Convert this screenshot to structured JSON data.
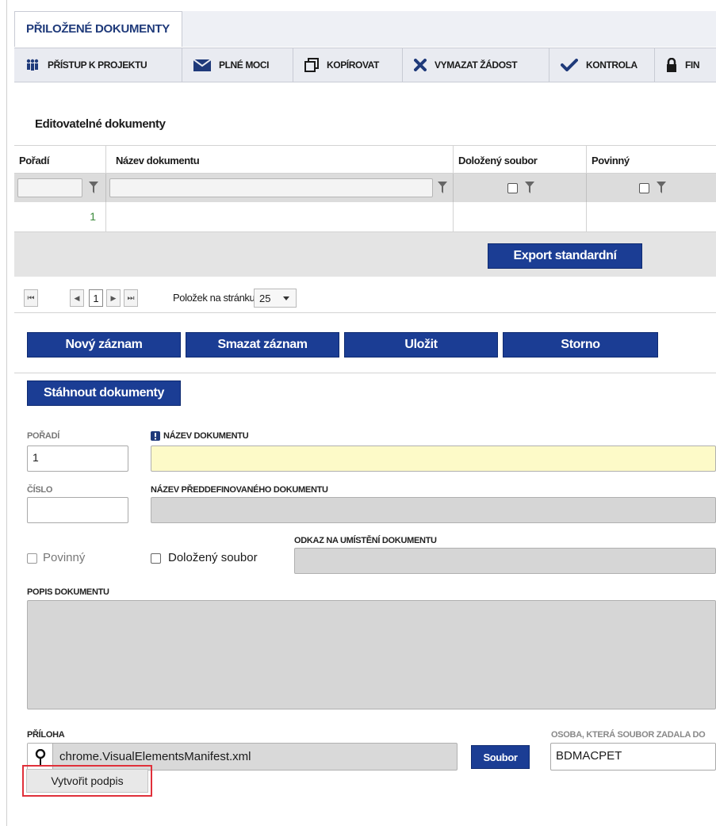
{
  "tab": {
    "title": "PŘILOŽENÉ DOKUMENTY"
  },
  "toolbar": [
    {
      "label": "PŘÍSTUP K PROJEKTU",
      "icon": "people-icon"
    },
    {
      "label": "PLNÉ MOCI",
      "icon": "envelope-icon"
    },
    {
      "label": "KOPÍROVAT",
      "icon": "copy-icon"
    },
    {
      "label": "VYMAZAT ŽÁDOST",
      "icon": "cross-icon"
    },
    {
      "label": "KONTROLA",
      "icon": "check-icon"
    },
    {
      "label": "FIN",
      "icon": "lock-icon"
    }
  ],
  "section_title": "Editovatelné dokumenty",
  "grid": {
    "columns": [
      "Pořadí",
      "Název dokumentu",
      "Doložený soubor",
      "Povinný"
    ],
    "rows": [
      {
        "poradi": "1",
        "nazev": "",
        "dolozeny": "",
        "povinny": ""
      }
    ],
    "export_label": "Export standardní"
  },
  "pager": {
    "first": "⏮",
    "prev": "◀",
    "current": "1",
    "next": "▶",
    "last": "⏭",
    "per_page_label": "Položek na stránku",
    "per_page_value": "25"
  },
  "actions": {
    "new": "Nový záznam",
    "delete": "Smazat záznam",
    "save": "Uložit",
    "cancel": "Storno",
    "download": "Stáhnout dokumenty"
  },
  "form": {
    "poradi_label": "POŘADÍ",
    "poradi_value": "1",
    "nazev_label": "NÁZEV DOKUMENTU",
    "nazev_value": "",
    "cislo_label": "ČÍSLO",
    "cislo_value": "",
    "predef_label": "NÁZEV PŘEDDEFINOVANÉHO DOKUMENTU",
    "povinny_label": "Povinný",
    "dolozeny_label": "Doložený soubor",
    "odkaz_label": "ODKAZ NA UMÍSTĚNÍ DOKUMENTU",
    "popis_label": "POPIS DOKUMENTU",
    "priloha_label": "PŘÍLOHA",
    "priloha_value": "chrome.VisualElementsManifest.xml",
    "soubor_button": "Soubor",
    "osoba_label": "OSOBA, KTERÁ SOUBOR ZADALA DO",
    "osoba_value": "BDMACPET",
    "vytvorit_button": "Vytvořit podpis"
  },
  "colors": {
    "primary_button": "#1b3d94",
    "highlight_border": "#e0303a",
    "required_field": "#fdfac8"
  }
}
